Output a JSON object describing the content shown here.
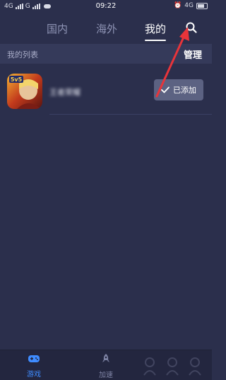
{
  "status_bar": {
    "carrier_left": "4G",
    "carrier_mid": "G",
    "time": "09:22",
    "network_right": "4G"
  },
  "top_tabs": [
    {
      "label": "国内",
      "active": false
    },
    {
      "label": "海外",
      "active": false
    },
    {
      "label": "我的",
      "active": true
    }
  ],
  "search": {
    "icon": "search-icon"
  },
  "list_section": {
    "title": "我的列表",
    "manage_label": "管理"
  },
  "games": [
    {
      "icon": "game-icon-honor-of-kings",
      "icon_badge": "5v5",
      "name": "王者荣耀",
      "name_blurred": true,
      "status_label": "已添加",
      "status_icon": "check-icon"
    }
  ],
  "bottom_nav": [
    {
      "label": "游戏",
      "icon": "gamepad-icon",
      "active": true
    },
    {
      "label": "加速",
      "icon": "rocket-icon",
      "active": false
    }
  ],
  "colors": {
    "background": "#2b2f4c",
    "header_band": "#353a5a",
    "added_button": "#5c6282",
    "accent": "#3f8cff",
    "annotation": "#e8343a"
  }
}
